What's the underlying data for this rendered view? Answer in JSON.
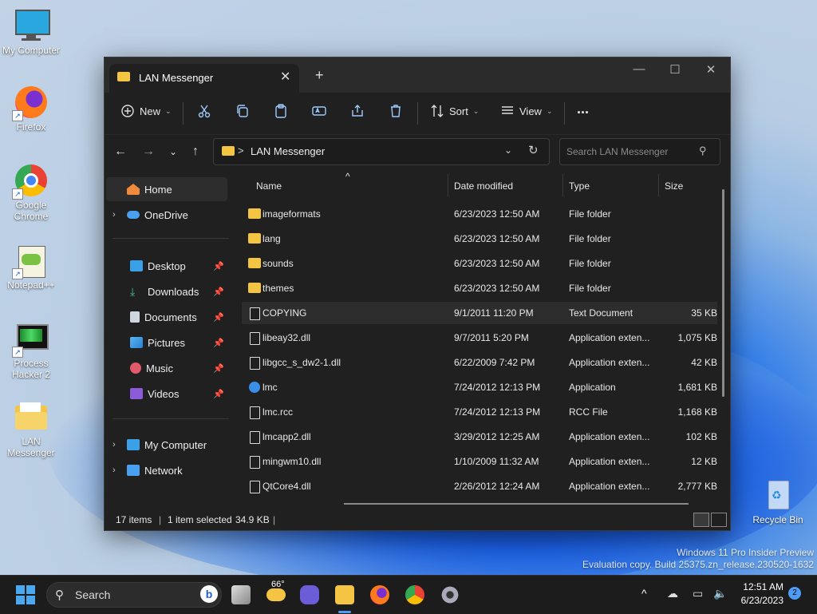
{
  "desktop": {
    "icons": [
      {
        "label": "My Computer",
        "icon": "monitor-icon"
      },
      {
        "label": "Firefox",
        "icon": "firefox-icon"
      },
      {
        "label": "Google Chrome",
        "icon": "chrome-icon"
      },
      {
        "label": "Notepad++",
        "icon": "notepadpp-icon"
      },
      {
        "label": "Process Hacker 2",
        "icon": "process-hacker-icon"
      },
      {
        "label": "LAN Messenger",
        "icon": "folder-icon"
      },
      {
        "label": "Recycle Bin",
        "icon": "recycle-bin-icon"
      }
    ],
    "watermark_line1": "Windows 11 Pro Insider Preview",
    "watermark_line2": "Evaluation copy. Build 25375.zn_release.230520-1632"
  },
  "window": {
    "tab_title": "LAN Messenger",
    "new_tab": "+",
    "toolbar": {
      "new_label": "New",
      "sort_label": "Sort",
      "view_label": "View",
      "more_label": "..."
    },
    "address": {
      "path": "LAN Messenger",
      "separator": ">"
    },
    "search": {
      "placeholder": "Search LAN Messenger"
    },
    "nav": {
      "home": "Home",
      "onedrive": "OneDrive",
      "quick": [
        "Desktop",
        "Downloads",
        "Documents",
        "Pictures",
        "Music",
        "Videos"
      ],
      "my_computer": "My Computer",
      "network": "Network"
    },
    "columns": {
      "name": "Name",
      "date": "Date modified",
      "type": "Type",
      "size": "Size"
    },
    "files": [
      {
        "name": "imageformats",
        "date": "6/23/2023 12:50 AM",
        "type": "File folder",
        "size": "",
        "kind": "folder"
      },
      {
        "name": "lang",
        "date": "6/23/2023 12:50 AM",
        "type": "File folder",
        "size": "",
        "kind": "folder"
      },
      {
        "name": "sounds",
        "date": "6/23/2023 12:50 AM",
        "type": "File folder",
        "size": "",
        "kind": "folder"
      },
      {
        "name": "themes",
        "date": "6/23/2023 12:50 AM",
        "type": "File folder",
        "size": "",
        "kind": "folder"
      },
      {
        "name": "COPYING",
        "date": "9/1/2011 11:20 PM",
        "type": "Text Document",
        "size": "35 KB",
        "kind": "doc"
      },
      {
        "name": "libeay32.dll",
        "date": "9/7/2011 5:20 PM",
        "type": "Application exten...",
        "size": "1,075 KB",
        "kind": "doc"
      },
      {
        "name": "libgcc_s_dw2-1.dll",
        "date": "6/22/2009 7:42 PM",
        "type": "Application exten...",
        "size": "42 KB",
        "kind": "doc"
      },
      {
        "name": "lmc",
        "date": "7/24/2012 12:13 PM",
        "type": "Application",
        "size": "1,681 KB",
        "kind": "app"
      },
      {
        "name": "lmc.rcc",
        "date": "7/24/2012 12:13 PM",
        "type": "RCC File",
        "size": "1,168 KB",
        "kind": "doc"
      },
      {
        "name": "lmcapp2.dll",
        "date": "3/29/2012 12:25 AM",
        "type": "Application exten...",
        "size": "102 KB",
        "kind": "doc"
      },
      {
        "name": "mingwm10.dll",
        "date": "1/10/2009 11:32 AM",
        "type": "Application exten...",
        "size": "12 KB",
        "kind": "doc"
      },
      {
        "name": "QtCore4.dll",
        "date": "2/26/2012 12:24 AM",
        "type": "Application exten...",
        "size": "2,777 KB",
        "kind": "doc"
      }
    ],
    "selected_index": 4,
    "status": {
      "items": "17 items",
      "selected": "1 item selected",
      "size": "34.9 KB",
      "sep": "|"
    }
  },
  "taskbar": {
    "search_label": "Search",
    "weather_temp": "66°",
    "time": "12:51 AM",
    "date": "6/23/2023",
    "notification_count": "2",
    "accent": "#4d9cf5"
  }
}
